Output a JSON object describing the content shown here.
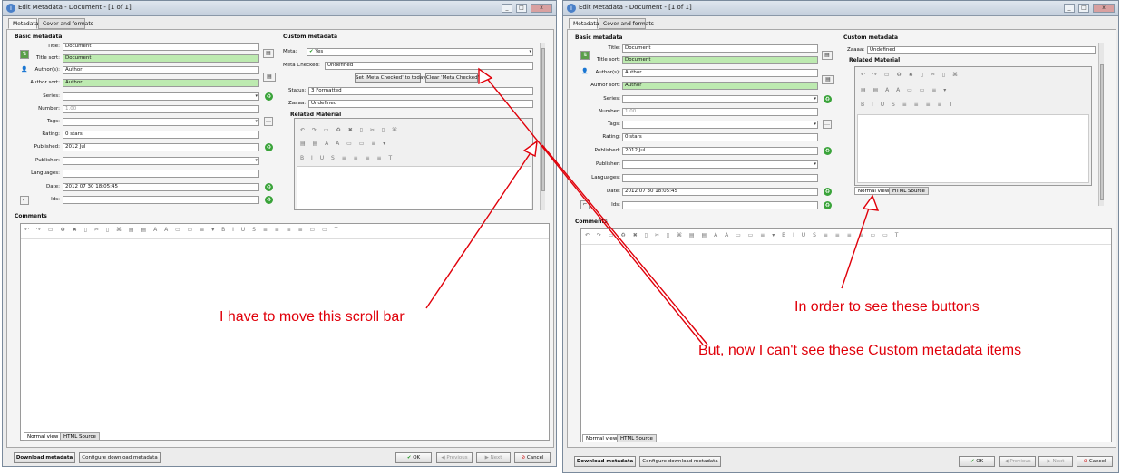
{
  "left": {
    "window_title": "Edit Metadata - Document - [1 of 1]",
    "tabs": [
      "Metadata",
      "Cover and formats"
    ],
    "basic_title": "Basic metadata",
    "custom_title": "Custom metadata",
    "labels": {
      "title": "Title:",
      "title_sort": "Title sort:",
      "authors": "Author(s):",
      "author_sort": "Author sort:",
      "series": "Series:",
      "number": "Number:",
      "tags": "Tags:",
      "rating": "Rating:",
      "published": "Published:",
      "publisher": "Publisher:",
      "languages": "Languages:",
      "date": "Date:",
      "ids": "Ids:"
    },
    "values": {
      "title": "Document",
      "title_sort": "Document",
      "authors": "Author",
      "author_sort": "Author",
      "number": "1.00",
      "rating": "0 stars",
      "published": "2012 Jul",
      "date": "2012 07 30 18:05:45"
    },
    "custom": {
      "meta_label": "Meta:",
      "meta_value": "Yes",
      "meta_checked_label": "Meta Checked:",
      "meta_checked_value": "Undefined",
      "set_btn": "Set 'Meta Checked' to today",
      "clear_btn": "Clear 'Meta Checked'",
      "status_label": "Status:",
      "status_value": "3 Formatted",
      "zaaaa_label": "Zaaaa:",
      "zaaaa_value": "Undefined",
      "related_label": "Related Material"
    },
    "comments_title": "Comments",
    "editor_tabs": [
      "Normal view",
      "HTML Source"
    ],
    "bottom": {
      "download": "Download metadata",
      "configure": "Configure download metadata",
      "ok": "OK",
      "previous": "Previous",
      "next": "Next",
      "cancel": "Cancel"
    }
  },
  "right": {
    "window_title": "Edit Metadata - Document - [1 of 1]",
    "tabs": [
      "Metadata",
      "Cover and formats"
    ],
    "basic_title": "Basic metadata",
    "custom_title": "Custom metadata",
    "labels": {
      "title": "Title:",
      "title_sort": "Title sort:",
      "authors": "Author(s):",
      "author_sort": "Author sort:",
      "series": "Series:",
      "number": "Number:",
      "tags": "Tags:",
      "rating": "Rating:",
      "published": "Published:",
      "publisher": "Publisher:",
      "languages": "Languages:",
      "date": "Date:",
      "ids": "Ids:"
    },
    "values": {
      "title": "Document",
      "title_sort": "Document",
      "authors": "Author",
      "author_sort": "Author",
      "number": "1.00",
      "rating": "0 stars",
      "published": "2012 Jul",
      "date": "2012 07 30 18:05:45"
    },
    "custom": {
      "zaaaa_label": "Zaaaa:",
      "zaaaa_value": "Undefined",
      "related_label": "Related Material"
    },
    "comments_title": "Comments",
    "editor_tabs": [
      "Normal view",
      "HTML Source"
    ],
    "bottom": {
      "download": "Download metadata",
      "configure": "Configure download metadata",
      "ok": "OK",
      "previous": "Previous",
      "next": "Next",
      "cancel": "Cancel"
    }
  },
  "annotations": {
    "scroll": "I have to move this scroll bar",
    "buttons": "In order to see these buttons",
    "items": "But, now I can't see these Custom metadata items"
  },
  "colors": {
    "annotation": "#e0000a",
    "green_field": "#bdeab0",
    "title_bar": "#c4cfdc"
  }
}
